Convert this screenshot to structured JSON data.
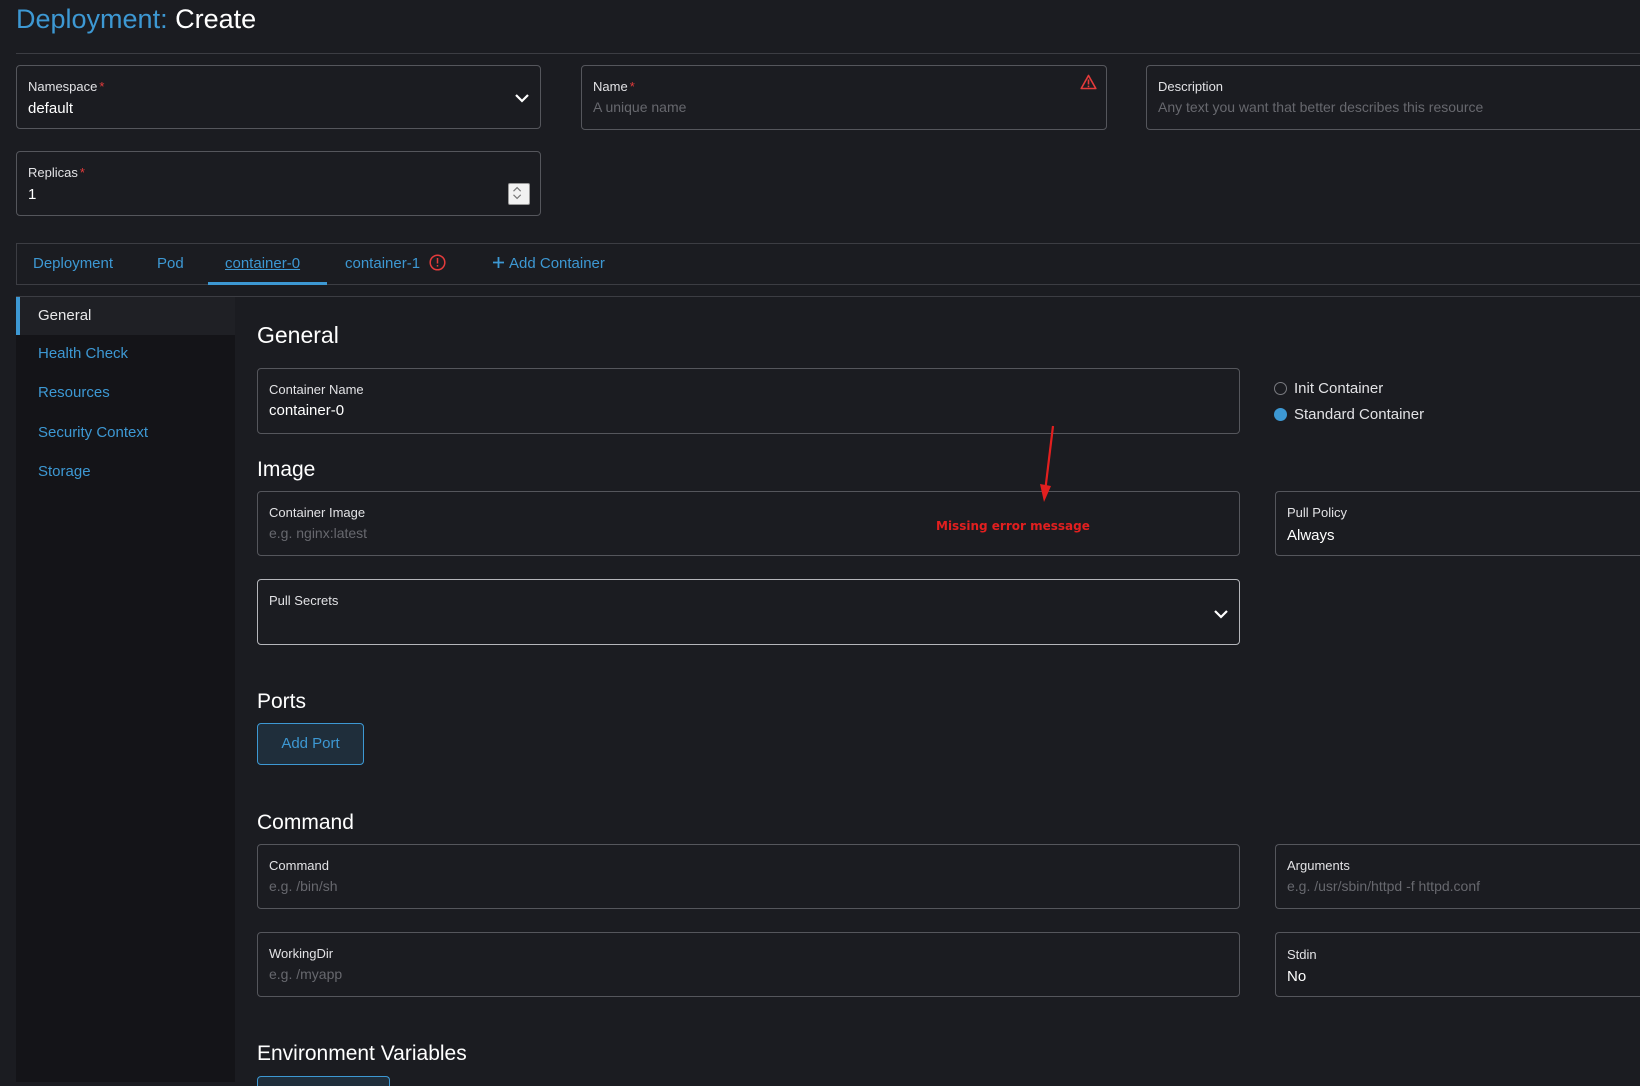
{
  "header": {
    "title_prefix": "Deployment:",
    "title_main": "Create"
  },
  "fields": {
    "namespace": {
      "label": "Namespace",
      "value": "default",
      "required_mark": "*"
    },
    "name": {
      "label": "Name",
      "placeholder": "A unique name",
      "required_mark": "*"
    },
    "description": {
      "label": "Description",
      "placeholder": "Any text you want that better describes this resource"
    },
    "replicas": {
      "label": "Replicas",
      "value": "1",
      "required_mark": "*"
    }
  },
  "tabs": [
    {
      "label": "Deployment"
    },
    {
      "label": "Pod"
    },
    {
      "label": "container-0",
      "active": true
    },
    {
      "label": "container-1",
      "error": true
    },
    {
      "label": "Add Container",
      "icon": "plus-icon"
    }
  ],
  "sidebar": {
    "items": [
      {
        "label": "General",
        "active": true
      },
      {
        "label": "Health Check"
      },
      {
        "label": "Resources"
      },
      {
        "label": "Security Context"
      },
      {
        "label": "Storage"
      }
    ]
  },
  "general": {
    "title": "General",
    "container_name": {
      "label": "Container Name",
      "value": "container-0"
    },
    "container_type": {
      "options": [
        "Init Container",
        "Standard Container"
      ],
      "selected": "Standard Container"
    }
  },
  "image": {
    "title": "Image",
    "container_image": {
      "label": "Container Image",
      "placeholder": "e.g. nginx:latest"
    },
    "pull_policy": {
      "label": "Pull Policy",
      "value": "Always"
    },
    "pull_secrets": {
      "label": "Pull Secrets"
    },
    "annotation": "Missing error message"
  },
  "ports": {
    "title": "Ports",
    "add_button": "Add Port"
  },
  "command": {
    "title": "Command",
    "command": {
      "label": "Command",
      "placeholder": "e.g. /bin/sh"
    },
    "arguments": {
      "label": "Arguments",
      "placeholder": "e.g. /usr/sbin/httpd -f httpd.conf"
    },
    "workingdir": {
      "label": "WorkingDir",
      "placeholder": "e.g. /myapp"
    },
    "stdin": {
      "label": "Stdin",
      "value": "No"
    }
  },
  "env": {
    "title": "Environment Variables"
  },
  "colors": {
    "accent": "#3d98d3",
    "error": "#e43b3b",
    "background": "#1b1c21",
    "sidebar": "#141418"
  }
}
